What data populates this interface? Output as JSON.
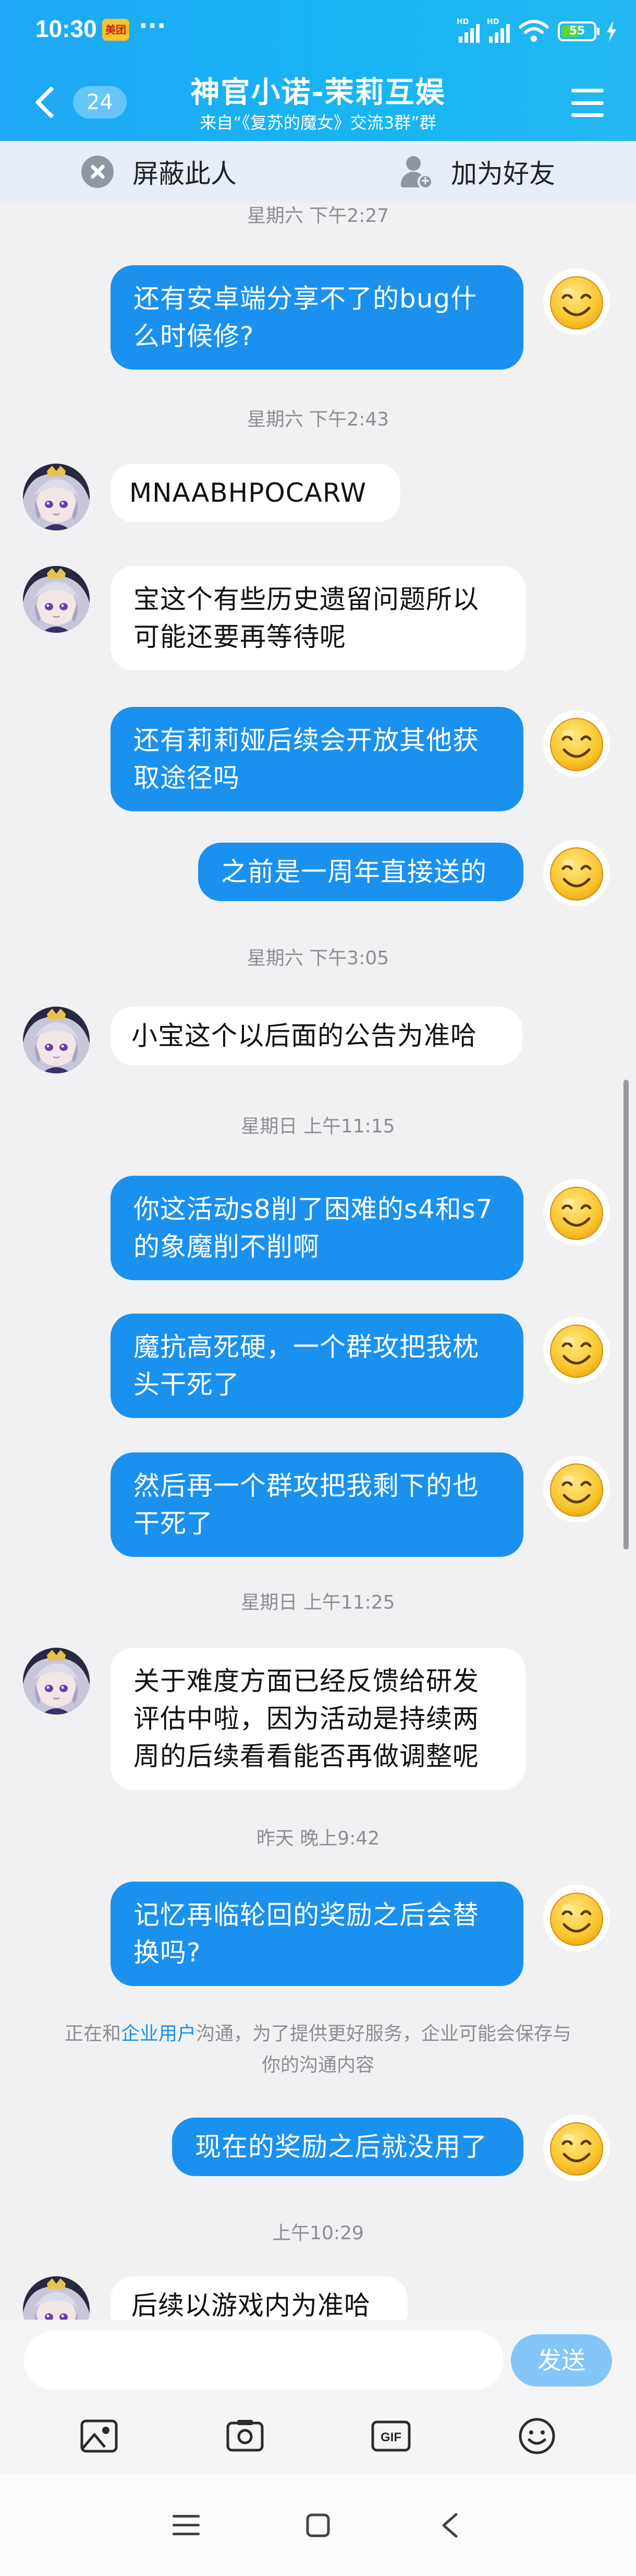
{
  "status": {
    "time": "10:30",
    "notif_label": "美团",
    "more": "···",
    "sim1": "HD",
    "sim2": "HD",
    "battery": "55",
    "battery_level": 0.55
  },
  "header": {
    "back_badge": "24",
    "title": "神官小诺-茉莉互娱",
    "subtitle": "来自“《复苏的魔女》交流3群”群"
  },
  "actions": {
    "block_label": "屏蔽此人",
    "add_friend_label": "加为好友"
  },
  "messages": {
    "t1": "星期六 下午2:27",
    "m1": [
      "还有安卓端分享不了的bug什",
      "么时候修?"
    ],
    "t2": "星期六 下午2:43",
    "m2": [
      "MNAABHPOCARW"
    ],
    "m3": [
      "宝这个有些历史遗留问题所以",
      "可能还要再等待呢"
    ],
    "m4": [
      "还有莉莉娅后续会开放其他获",
      "取途径吗"
    ],
    "m5": [
      "之前是一周年直接送的"
    ],
    "t3": "星期六 下午3:05",
    "m6": [
      "小宝这个以后面的公告为准哈"
    ],
    "t4": "星期日 上午11:15",
    "m7": [
      "你这活动s8削了困难的s4和s7",
      "的象魔削不削啊"
    ],
    "m8": [
      "魔抗高死硬，一个群攻把我枕",
      "头干死了"
    ],
    "m9": [
      "然后再一个群攻把我剩下的也",
      "干死了"
    ],
    "t5": "星期日 上午11:25",
    "m10": [
      "关于难度方面已经反馈给研发",
      "评估中啦，因为活动是持续两",
      "周的后续看看能否再做调整呢"
    ],
    "t6": "昨天 晚上9:42",
    "m11": [
      "记忆再临轮回的奖励之后会替",
      "换吗?"
    ],
    "notice_pre": "正在和",
    "notice_hl": "企业用户",
    "notice_post": "沟通，为了提供更好服务，企业可能会保存与",
    "notice_line2": "你的沟通内容",
    "m12": [
      "现在的奖励之后就没用了"
    ],
    "t7": "上午10:29",
    "m13": [
      "后续以游戏内为准哈"
    ]
  },
  "input": {
    "placeholder": "",
    "send_label": "发送"
  },
  "toolbar": {
    "gif_label": "GIF"
  },
  "colors": {
    "header": "#1fa8f5",
    "bubble_out": "#1a91ee",
    "bubble_in": "#ffffff",
    "background": "#f1f1f3"
  }
}
